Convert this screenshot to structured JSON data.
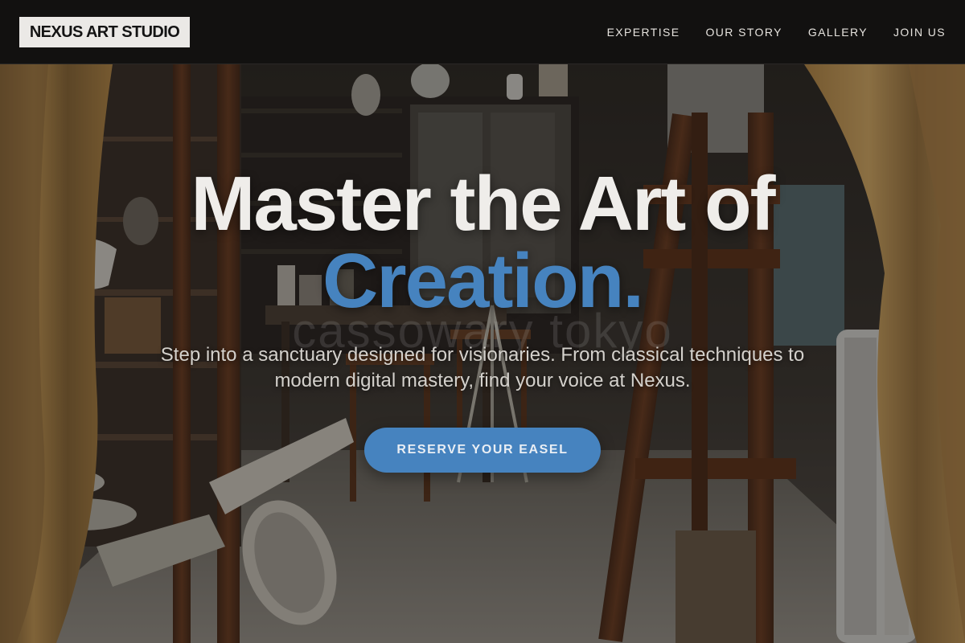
{
  "header": {
    "logo": "NEXUS ART STUDIO",
    "nav": [
      {
        "label": "EXPERTISE"
      },
      {
        "label": "OUR STORY"
      },
      {
        "label": "GALLERY"
      },
      {
        "label": "JOIN US"
      }
    ]
  },
  "hero": {
    "headline_line1": "Master the Art of",
    "headline_accent": "Creation.",
    "watermark": "cassowary tokyo",
    "subtext": "Step into a sanctuary designed for visionaries. From classical techniques to modern digital mastery, find your voice at Nexus.",
    "cta_label": "RESERVE YOUR EASEL"
  },
  "colors": {
    "header_bg": "#121110",
    "logo_bg": "#ebe9e6",
    "accent": "#4683bf",
    "headline": "#efedea",
    "subtext": "#d4d1cc"
  }
}
